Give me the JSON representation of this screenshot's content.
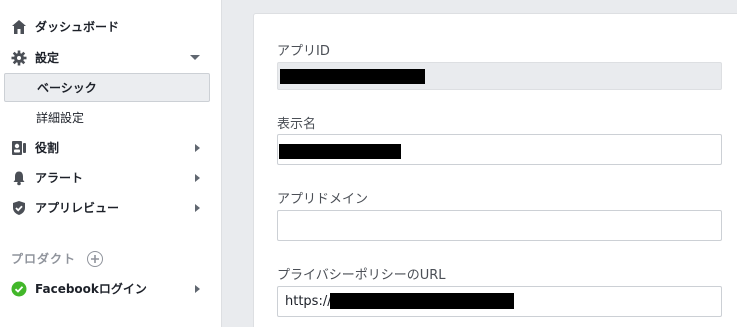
{
  "sidebar": {
    "items": [
      {
        "label": "ダッシュボード",
        "icon": "home-icon"
      },
      {
        "label": "設定",
        "icon": "gear-icon",
        "expanded": true
      },
      {
        "label": "役割",
        "icon": "roles-icon"
      },
      {
        "label": "アラート",
        "icon": "bell-icon"
      },
      {
        "label": "アプリレビュー",
        "icon": "shield-check-icon"
      }
    ],
    "settings_subitems": [
      {
        "label": "ベーシック",
        "active": true
      },
      {
        "label": "詳細設定",
        "active": false
      }
    ],
    "products_label": "プロダクト",
    "products": [
      {
        "label": "Facebookログイン",
        "icon": "check-circle-icon",
        "status_color": "#42b72a"
      }
    ]
  },
  "form": {
    "app_id": {
      "label": "アプリID",
      "value": ""
    },
    "display_name": {
      "label": "表示名",
      "value": ""
    },
    "app_domain": {
      "label": "アプリドメイン",
      "value": ""
    },
    "privacy_url": {
      "label": "プライバシーポリシーのURL",
      "value_prefix": "https://"
    }
  },
  "colors": {
    "sidebar_bg": "#ffffff",
    "page_bg": "#e9ebee",
    "active_bg": "#ebedf0",
    "success": "#42b72a",
    "icon": "#4b4f56"
  }
}
